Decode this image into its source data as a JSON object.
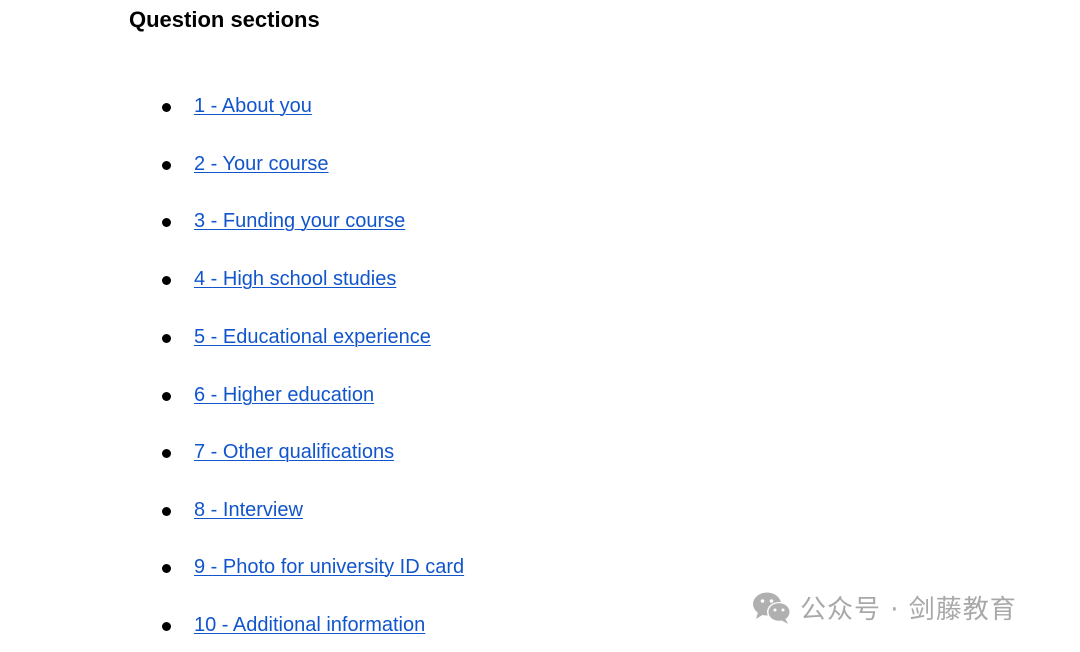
{
  "page": {
    "title": "Question sections"
  },
  "sections": [
    {
      "label": "1 - About you"
    },
    {
      "label": "2 - Your course"
    },
    {
      "label": "3 - Funding your course"
    },
    {
      "label": "4 - High school studies"
    },
    {
      "label": "5 - Educational experience"
    },
    {
      "label": "6 - Higher education"
    },
    {
      "label": "7 - Other qualifications"
    },
    {
      "label": "8 - Interview"
    },
    {
      "label": "9 - Photo for university ID card"
    },
    {
      "label": "10 - Additional information"
    }
  ],
  "colors": {
    "link": "#1155cc",
    "watermark": "#a8a8a8"
  },
  "watermark": {
    "icon": "wechat-icon",
    "text": "公众号 · 剑藤教育"
  }
}
